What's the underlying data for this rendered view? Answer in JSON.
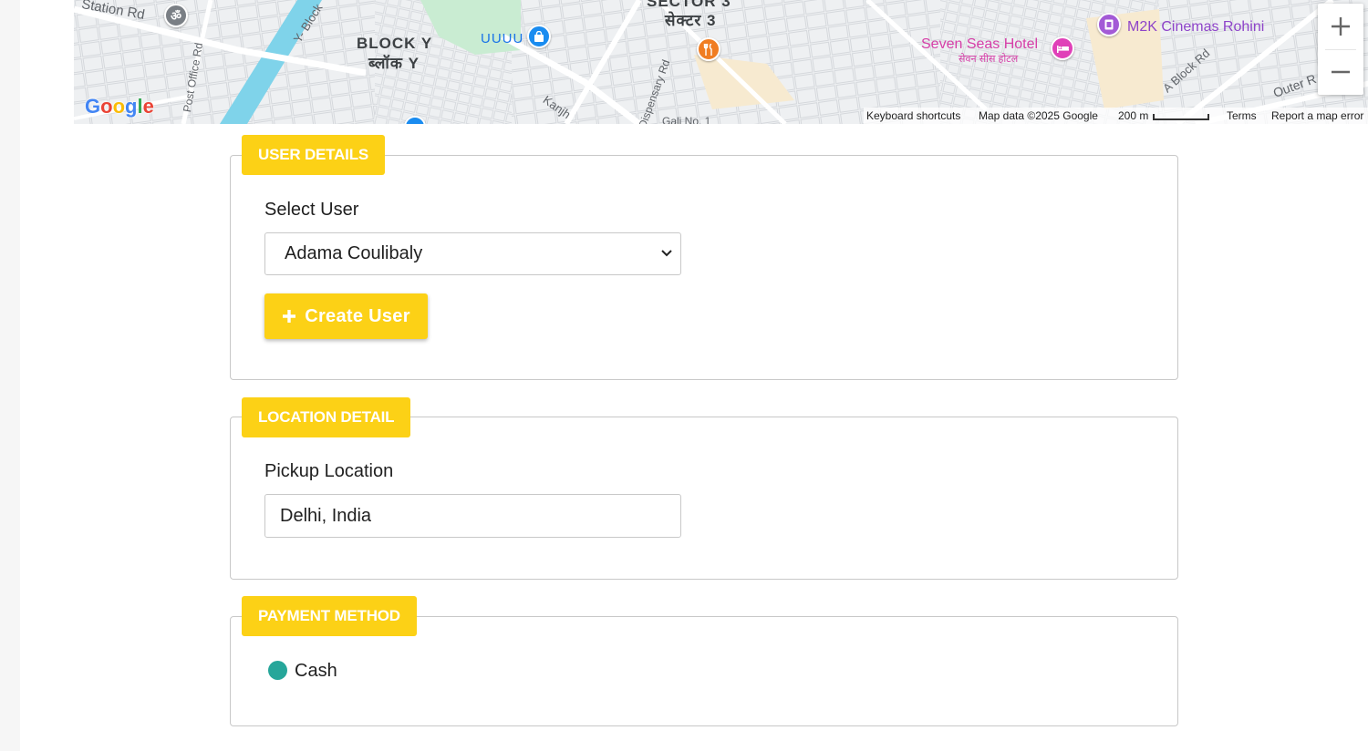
{
  "map": {
    "labels": {
      "station_rd": "Station Rd",
      "block_y": "BLOCK Y",
      "block_y_hindi": "ब्लॉक Y",
      "y_block": "Y- Block",
      "post_office_rd": "Post Office Rd",
      "uuuu": "UUUU",
      "sector_3": "SECTOR 3",
      "sector_3_hindi": "सेक्टर 3",
      "dispensary_rd": "Dispensary Rd",
      "gali_no_1": "Gali No. 1",
      "kanjh": "Kanjh",
      "seven_seas": "Seven Seas Hotel",
      "seven_seas_hindi": "सेवन सीस होटल",
      "m2k": "M2K Cinemas Rohini",
      "a_block_rd": "A Block Rd",
      "outer_r": "Outer R"
    },
    "google_logo": "Google",
    "attribution": {
      "keyboard": "Keyboard shortcuts",
      "map_data": "Map data ©2025 Google",
      "scale": "200 m",
      "terms": "Terms",
      "report": "Report a map error"
    },
    "zoom_in": "+",
    "zoom_out": "−",
    "colors": {
      "water": "#7fd3ea",
      "park": "#c9ecd2",
      "road": "#ffffff",
      "block": "#dadce0"
    }
  },
  "sections": {
    "user": {
      "legend": "USER DETAILS",
      "select_label": "Select User",
      "selected_user": "Adama Coulibaly",
      "create_button": "Create User"
    },
    "location": {
      "legend": "LOCATION DETAIL",
      "pickup_label": "Pickup Location",
      "pickup_value": "Delhi, India"
    },
    "payment": {
      "legend": "PAYMENT METHOD",
      "option": "Cash"
    }
  },
  "colors": {
    "accent": "#fcd116",
    "radio": "#26a69a",
    "border": "#c8c8c8"
  }
}
